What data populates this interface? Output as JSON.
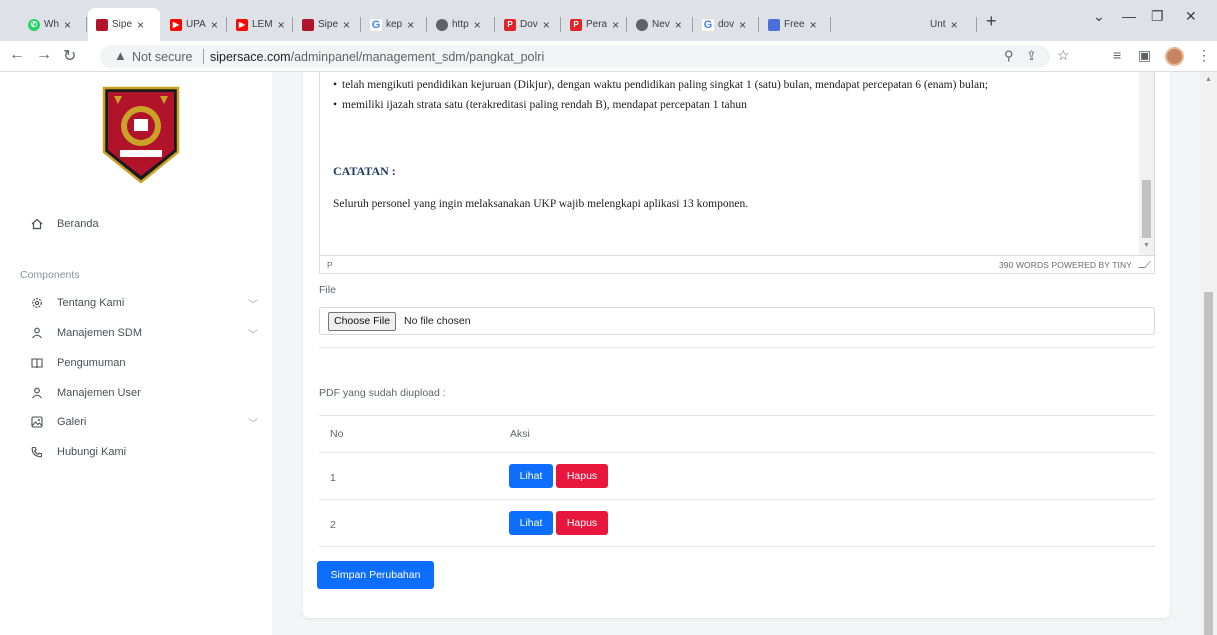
{
  "browser": {
    "tabs": [
      {
        "label": "Wh",
        "favicon": "whatsapp-icon",
        "color": "#25d366"
      },
      {
        "label": "Sipe",
        "favicon": "shield-crest-icon",
        "color": "#b0132a"
      },
      {
        "label": "UPA",
        "favicon": "youtube-icon",
        "color": "#ff0000"
      },
      {
        "label": "LEM",
        "favicon": "youtube-icon",
        "color": "#ff0000"
      },
      {
        "label": "Sipe",
        "favicon": "shield-crest-icon",
        "color": "#b0132a"
      },
      {
        "label": "kep",
        "favicon": "google-icon",
        "color": "#4285f4"
      },
      {
        "label": "http",
        "favicon": "globe-icon",
        "color": "#5f6368"
      },
      {
        "label": "Dov",
        "favicon": "pdf-icon",
        "color": "#e0242a"
      },
      {
        "label": "Pera",
        "favicon": "pdf-icon",
        "color": "#e0242a"
      },
      {
        "label": "Nev",
        "favicon": "chrome-icon",
        "color": "#5f6368"
      },
      {
        "label": "dov",
        "favicon": "google-icon",
        "color": "#4285f4"
      },
      {
        "label": "Free",
        "favicon": "app-icon",
        "color": "#4b6fd8"
      },
      {
        "label": "Unt",
        "favicon": "blank-icon",
        "color": "#dee1e6"
      }
    ],
    "new_tab": "+",
    "security_label": "Not secure",
    "url_domain": "sipersace.com",
    "url_path": "/adminpanel/management_sdm/pangkat_polri"
  },
  "sidebar": {
    "home_label": "Beranda",
    "caption": "Components",
    "items": [
      {
        "label": "Tentang Kami",
        "icon": "gear-icon",
        "expandable": true
      },
      {
        "label": "Manajemen SDM",
        "icon": "user-icon",
        "expandable": true
      },
      {
        "label": "Pengumuman",
        "icon": "book-icon",
        "expandable": false
      },
      {
        "label": "Manajemen User",
        "icon": "user-icon",
        "expandable": false
      },
      {
        "label": "Galeri",
        "icon": "image-icon",
        "expandable": true
      },
      {
        "label": "Hubungi Kami",
        "icon": "phone-icon",
        "expandable": false
      }
    ]
  },
  "editor": {
    "bullets": [
      "telah mengikuti pendidikan kejuruan (Dikjur), dengan waktu pendidikan paling singkat 1 (satu) bulan, mendapat percepatan 6 (enam) bulan;",
      "memiliki ijazah strata satu (terakreditasi paling rendah B), mendapat percepatan 1 tahun"
    ],
    "heading": "CATATAN :",
    "paragraph": "Seluruh personel yang ingin melaksanakan UKP wajib melengkapi aplikasi 13 komponen.",
    "status_path": "P",
    "status_count": "390 WORDS  POWERED BY TINY"
  },
  "file_field": {
    "label": "File",
    "button": "Choose File",
    "status": "No file chosen"
  },
  "uploaded": {
    "label": "PDF yang sudah diupload :",
    "columns": [
      "No",
      "Aksi"
    ],
    "rows": [
      {
        "no": "1",
        "view": "Lihat",
        "delete": "Hapus"
      },
      {
        "no": "2",
        "view": "Lihat",
        "delete": "Hapus"
      }
    ]
  },
  "save_button": "Simpan Perubahan",
  "colors": {
    "primary": "#0d6efd",
    "danger": "#e8163c",
    "heading_navy": "#1f3864"
  }
}
